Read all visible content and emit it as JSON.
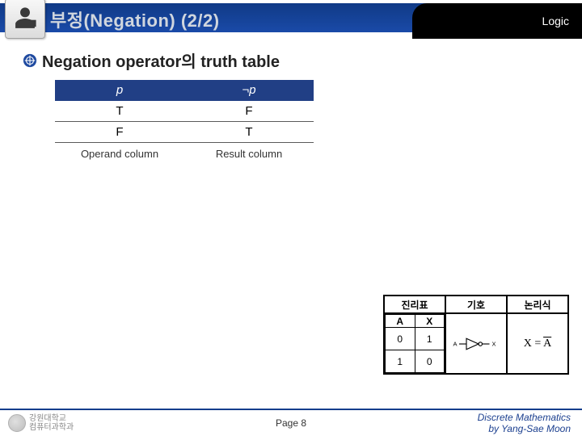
{
  "header": {
    "title": "부정(Negation) (2/2)",
    "badge": "Logic"
  },
  "section": {
    "heading": "Negation operator의 truth table"
  },
  "truth": {
    "col1_header": "p",
    "col2_header": "¬p",
    "rows": [
      {
        "p": "T",
        "np": "F"
      },
      {
        "p": "F",
        "np": "T"
      }
    ],
    "operand_label": "Operand column",
    "result_label": "Result column"
  },
  "figure": {
    "headers": [
      "진리표",
      "기호",
      "논리식"
    ],
    "truth_header_a": "A",
    "truth_header_x": "X",
    "truth_rows": [
      {
        "a": "0",
        "x": "1"
      },
      {
        "a": "1",
        "x": "0"
      }
    ],
    "gate_in": "A",
    "gate_out": "X",
    "expr_lhs": "X",
    "expr_eq": "=",
    "expr_rhs": "A"
  },
  "footer": {
    "page_label": "Page 8",
    "credit_line1": "Discrete Mathematics",
    "credit_line2": "by Yang-Sae Moon",
    "inst_line1": "강원대학교",
    "inst_line2": "컴퓨터과학과"
  }
}
